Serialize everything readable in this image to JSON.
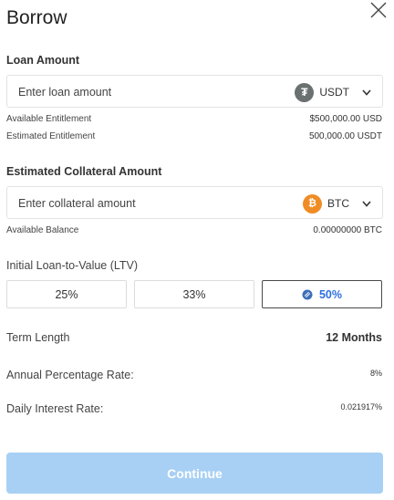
{
  "dialog": {
    "title": "Borrow"
  },
  "loan": {
    "section_label": "Loan Amount",
    "placeholder": "Enter loan amount",
    "token": "USDT",
    "token_icon": "tether-icon",
    "available_entitlement_label": "Available Entitlement",
    "available_entitlement_value": "$500,000.00 USD",
    "estimated_entitlement_label": "Estimated Entitlement",
    "estimated_entitlement_value": "500,000.00 USDT"
  },
  "collateral": {
    "section_label": "Estimated Collateral Amount",
    "placeholder": "Enter collateral amount",
    "token": "BTC",
    "token_icon": "bitcoin-icon",
    "available_balance_label": "Available Balance",
    "available_balance_value": "0.00000000 BTC"
  },
  "ltv": {
    "label": "Initial Loan-to-Value (LTV)",
    "options": [
      {
        "label": "25%"
      },
      {
        "label": "33%"
      },
      {
        "label": "50%",
        "selected": true
      }
    ]
  },
  "details": {
    "term_label": "Term Length",
    "term_value": "12 Months",
    "apr_label": "Annual Percentage Rate:",
    "apr_value": "8%",
    "daily_label": "Daily Interest Rate:",
    "daily_value": "0.021917%"
  },
  "actions": {
    "continue_label": "Continue"
  },
  "colors": {
    "continue_bg": "#a8d0f4",
    "selected_accent": "#2f6fe0",
    "btc_orange": "#f08c25",
    "usdt_gray": "#6b7071"
  }
}
